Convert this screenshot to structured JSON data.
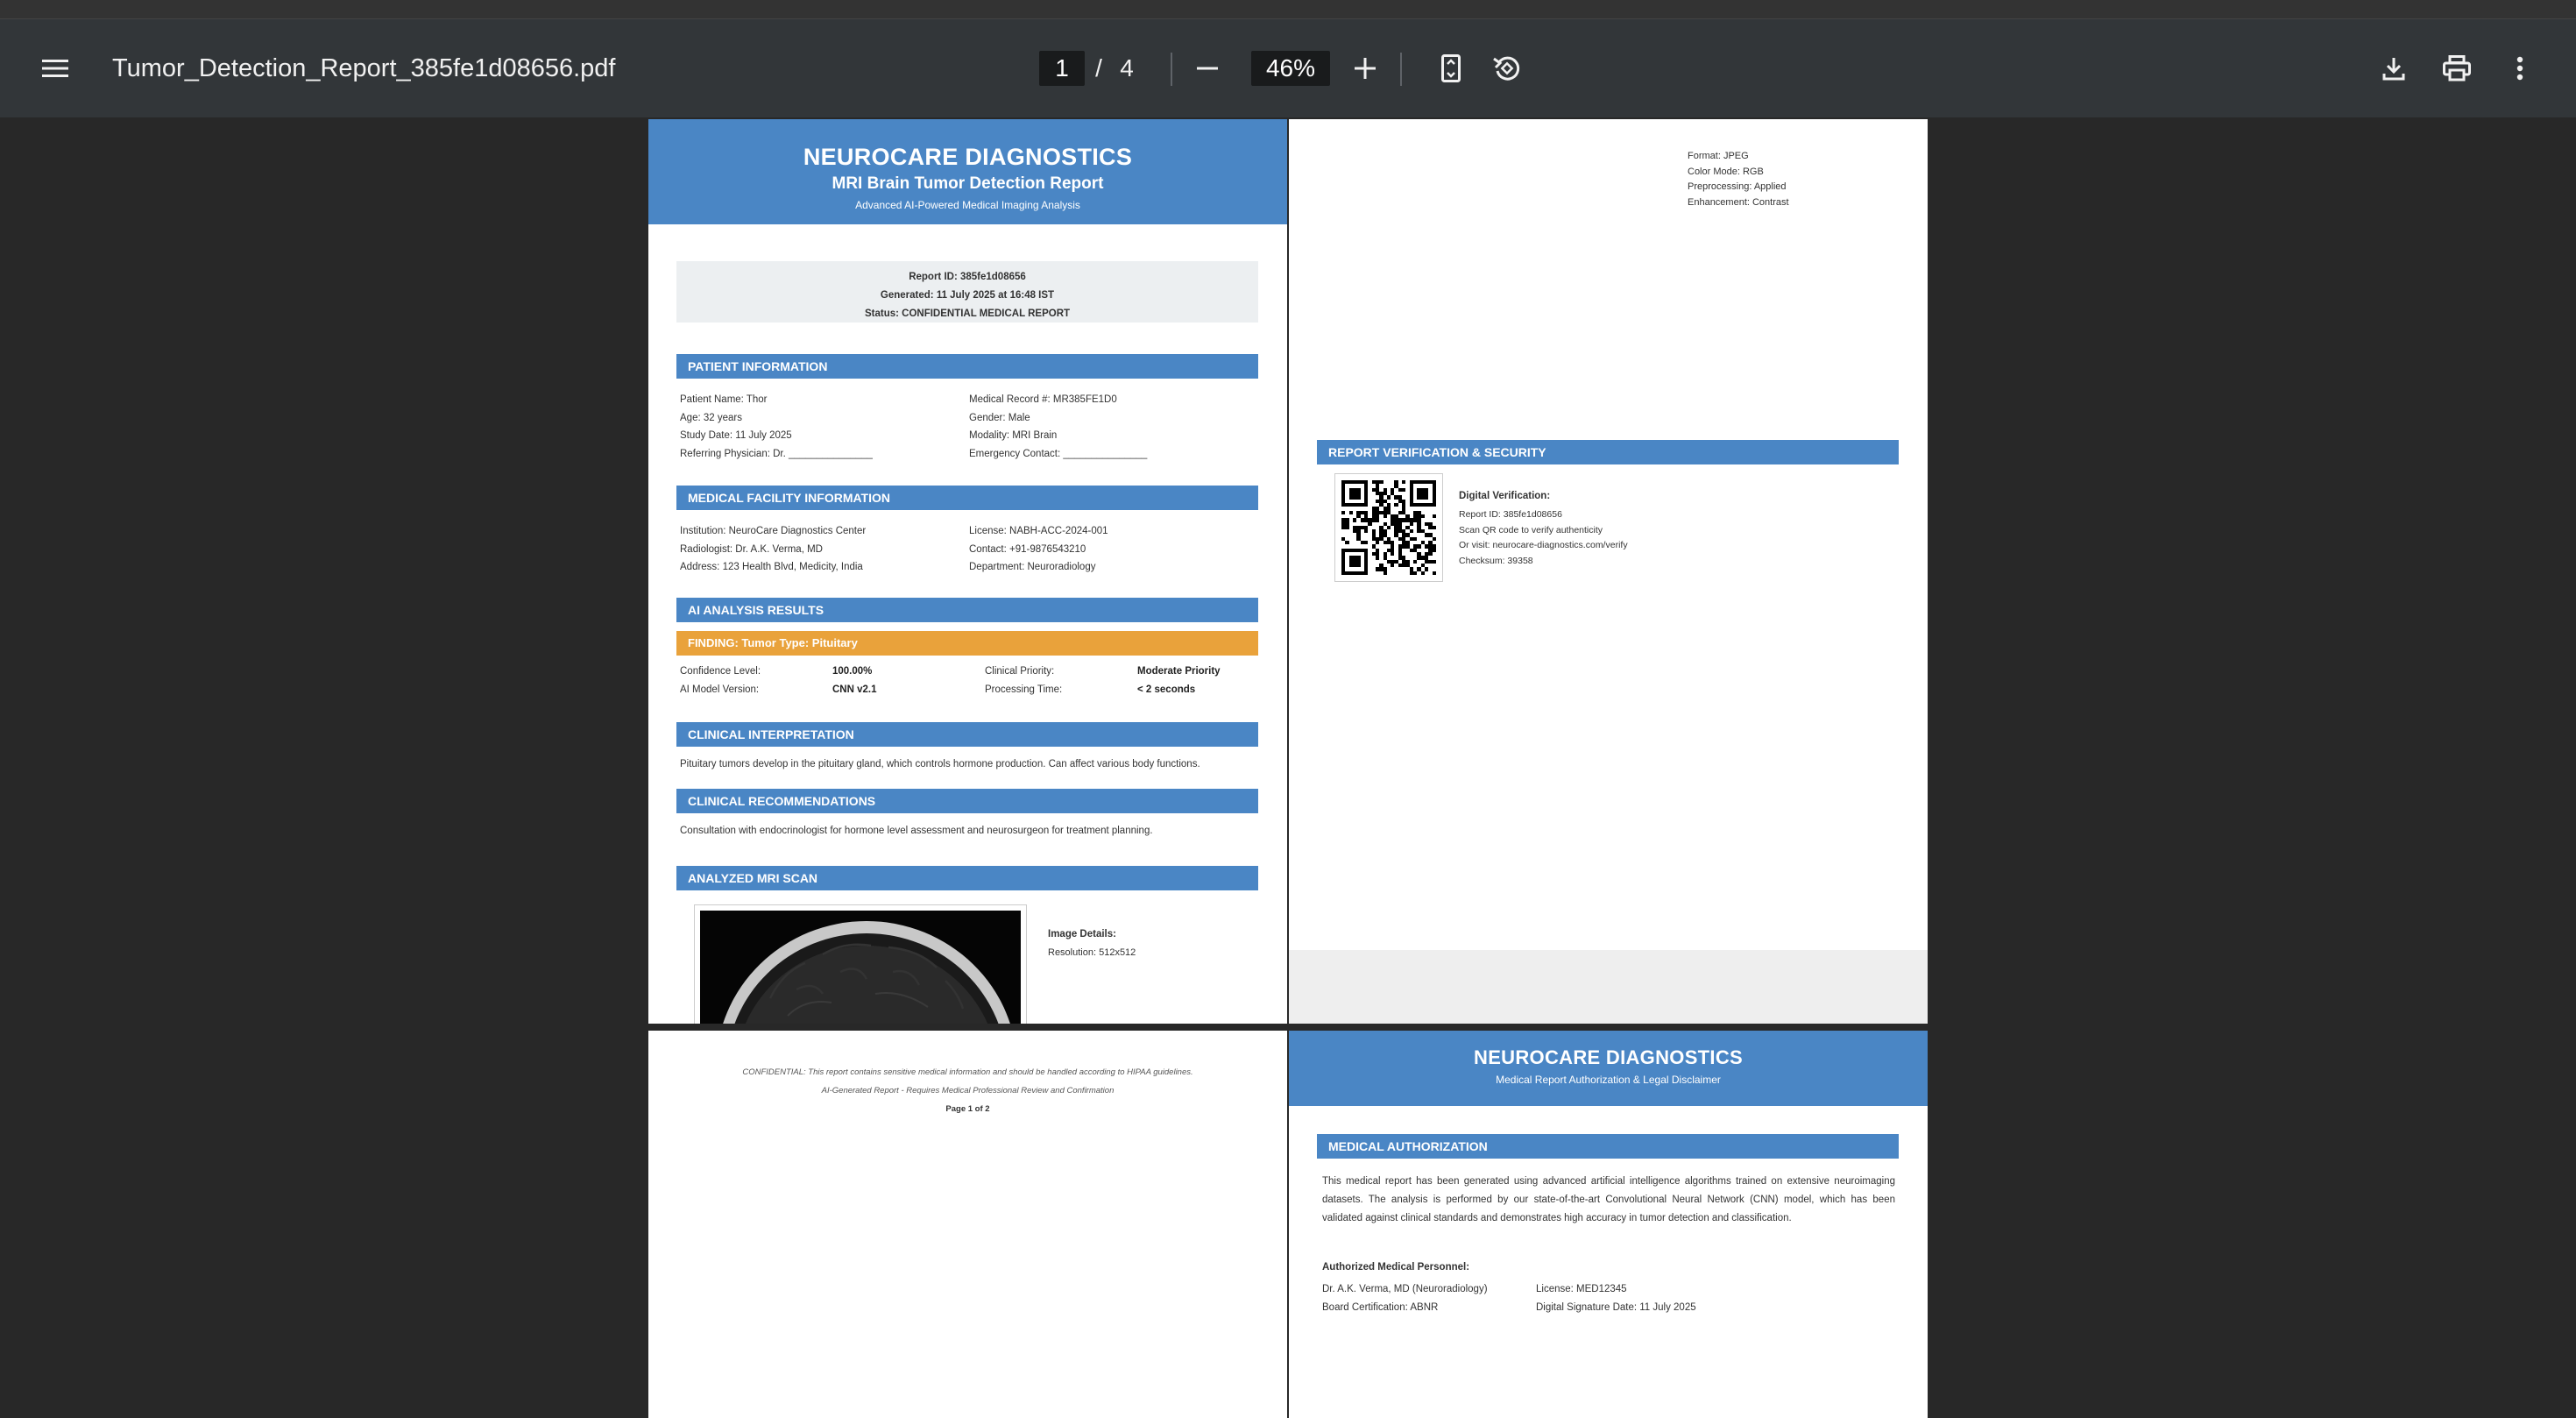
{
  "toolbar": {
    "title": "Tumor_Detection_Report_385fe1d08656.pdf",
    "page_current": "1",
    "page_separator": "/",
    "page_total": "4",
    "zoom": "46%"
  },
  "page1": {
    "org": "NEUROCARE DIAGNOSTICS",
    "report_title": "MRI Brain Tumor Detection Report",
    "subtitle": "Advanced AI-Powered Medical Imaging Analysis",
    "report_id": "Report ID: 385fe1d08656",
    "generated": "Generated: 11 July 2025 at 16:48 IST",
    "status": "Status: CONFIDENTIAL MEDICAL REPORT",
    "patient_header": "PATIENT INFORMATION",
    "patient_left": [
      "Patient Name: Thor",
      "Age: 32 years",
      "Study Date: 11 July 2025",
      "Referring Physician: Dr. _______________"
    ],
    "patient_right": [
      "Medical Record #: MR385FE1D0",
      "Gender: Male",
      "Modality: MRI Brain",
      "Emergency Contact: _______________"
    ],
    "facility_header": "MEDICAL FACILITY INFORMATION",
    "facility_left": [
      "Institution: NeuroCare Diagnostics Center",
      "Radiologist: Dr. A.K. Verma, MD",
      "Address: 123 Health Blvd, Medicity, India"
    ],
    "facility_right": [
      "License: NABH-ACC-2024-001",
      "Contact: +91-9876543210",
      "Department: Neuroradiology"
    ],
    "ai_header": "AI ANALYSIS RESULTS",
    "finding": "FINDING: Tumor Type: Pituitary",
    "confidence_label": "Confidence Level:",
    "confidence_value": "100.00%",
    "priority_label": "Clinical Priority:",
    "priority_value": "Moderate Priority",
    "model_label": "AI Model Version:",
    "model_value": "CNN v2.1",
    "processing_label": "Processing Time:",
    "processing_value": "< 2 seconds",
    "interp_header": "CLINICAL INTERPRETATION",
    "interp_text": "Pituitary tumors develop in the pituitary gland, which controls hormone production. Can affect various body functions.",
    "recs_header": "CLINICAL RECOMMENDATIONS",
    "recs_text": "Consultation with endocrinologist for hormone level assessment and neurosurgeon for treatment planning.",
    "scan_header": "ANALYZED MRI SCAN",
    "image_details_label": "Image Details:",
    "resolution": "Resolution: 512x512"
  },
  "page2": {
    "format_lines": [
      "Format: JPEG",
      "Color Mode: RGB",
      "Preprocessing: Applied",
      "Enhancement: Contrast"
    ],
    "verify_header": "REPORT VERIFICATION & SECURITY",
    "digital_label": "Digital Verification:",
    "verify_lines": [
      "Report ID: 385fe1d08656",
      "Scan QR code to verify authenticity",
      "Or visit: neurocare-diagnostics.com/verify",
      "Checksum: 39358"
    ]
  },
  "page3": {
    "confidential": "CONFIDENTIAL: This report contains sensitive medical information and should be handled according to HIPAA guidelines.",
    "ai_generated": "AI-Generated Report - Requires Medical Professional Review and Confirmation",
    "page_label": "Page 1 of 2"
  },
  "page4": {
    "org": "NEUROCARE DIAGNOSTICS",
    "subtitle": "Medical Report Authorization & Legal Disclaimer",
    "auth_header": "MEDICAL AUTHORIZATION",
    "auth_text": "This medical report has been generated using advanced artificial intelligence algorithms trained on extensive neuroimaging datasets. The analysis is performed by our state-of-the-art Convolutional Neural Network (CNN) model, which has been validated against clinical standards and demonstrates high accuracy in tumor detection and classification.",
    "personnel_label": "Authorized Medical Personnel:",
    "personnel_left": [
      "Dr. A.K. Verma, MD (Neuroradiology)",
      "Board Certification: ABNR"
    ],
    "personnel_right": [
      "License: MED12345",
      "Digital Signature Date: 11 July 2025"
    ]
  },
  "icons": [
    "menu-icon",
    "zoom-out-icon",
    "zoom-in-icon",
    "fit-page-icon",
    "rotate-icon",
    "download-icon",
    "print-icon",
    "more-vert-icon"
  ],
  "colors": {
    "toolbar": "#323639",
    "viewer": "#282828",
    "header_blue": "#4a86c5",
    "finding_orange": "#e9a23b"
  }
}
